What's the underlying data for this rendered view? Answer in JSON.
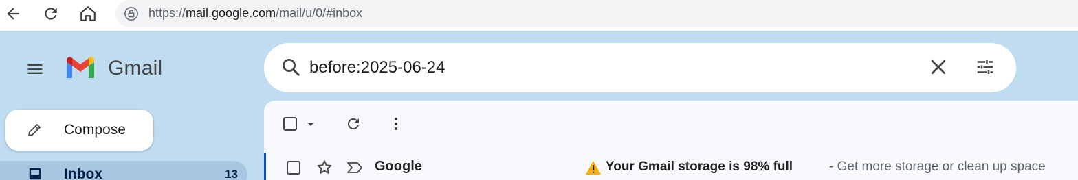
{
  "browser": {
    "url_prefix": "https://",
    "url_host": "mail.google.com",
    "url_path": "/mail/u/0/#inbox"
  },
  "app": {
    "name": "Gmail"
  },
  "search": {
    "value": "before:2025-06-24"
  },
  "sidebar": {
    "compose_label": "Compose",
    "items": [
      {
        "label": "Inbox",
        "count": "13",
        "icon": "inbox-icon"
      }
    ]
  },
  "email_list": {
    "rows": [
      {
        "sender": "Google",
        "subject": "Your Gmail storage is 98% full",
        "snippet": " - Get more storage or clean up space",
        "icon": "warning-icon"
      }
    ]
  },
  "colors": {
    "app_background": "#bfdcf0",
    "selected_nav": "#a9c7e0",
    "accent": "#0b57d0"
  }
}
